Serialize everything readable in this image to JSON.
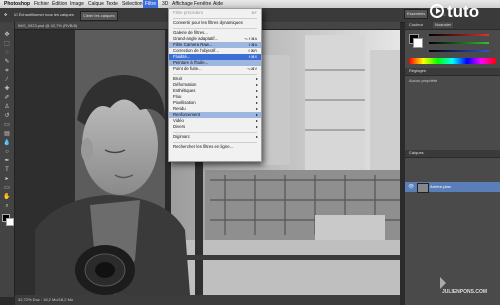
{
  "menubar": {
    "app": "Photoshop",
    "items": [
      "Fichier",
      "Édition",
      "Image",
      "Calque",
      "Texte",
      "Sélection",
      "Filtre",
      "3D",
      "Affichage",
      "Fenêtre",
      "Aide"
    ],
    "active": "Filtre"
  },
  "options_bar": {
    "items": [
      "Échantillonner tous les calques",
      "Cibler les calques",
      "Essentiels",
      "CC"
    ]
  },
  "document": {
    "tab_label": "IMG_0923.psd @ 42,7% (RVB/8)",
    "status_text": "42,72%   Doc : 18,2 Mo/18,2 Mo"
  },
  "filter_menu": {
    "items": [
      {
        "label": "Filtre précédent",
        "shortcut": "⌘F",
        "state": "disabled"
      },
      {
        "label": "",
        "separator": true
      },
      {
        "label": "Convertir pour les filtres dynamiques"
      },
      {
        "label": "",
        "separator": true
      },
      {
        "label": "Galerie de filtres..."
      },
      {
        "label": "Grand-angle adaptatif...",
        "shortcut": "⌥⇧⌘A"
      },
      {
        "label": "Filtre Camera Raw...",
        "shortcut": "⇧⌘A",
        "state": "highlight2"
      },
      {
        "label": "Correction de l'objectif...",
        "shortcut": "⇧⌘R"
      },
      {
        "label": "Fluidité...",
        "shortcut": "⇧⌘X",
        "state": "highlight"
      },
      {
        "label": "Peinture à l'huile...",
        "state": "highlight2"
      },
      {
        "label": "Point de fuite...",
        "shortcut": "⌥⌘V"
      },
      {
        "label": "",
        "separator": true
      },
      {
        "label": "Bruit",
        "submenu": true
      },
      {
        "label": "Déformation",
        "submenu": true
      },
      {
        "label": "Esthétiques",
        "submenu": true
      },
      {
        "label": "Flou",
        "submenu": true
      },
      {
        "label": "Pixellisation",
        "submenu": true
      },
      {
        "label": "Rendu",
        "submenu": true
      },
      {
        "label": "Renforcement",
        "submenu": true,
        "state": "highlight2"
      },
      {
        "label": "Vidéo",
        "submenu": true
      },
      {
        "label": "Divers",
        "submenu": true
      },
      {
        "label": "",
        "separator": true
      },
      {
        "label": "Digimarc",
        "submenu": true
      },
      {
        "label": "",
        "separator": true
      },
      {
        "label": "Rechercher les filtres en ligne..."
      }
    ]
  },
  "panels": {
    "color_tab": "Couleur",
    "swatches_tab": "Nuancier",
    "adjust_tab": "Réglages",
    "styles_tab": "Aucun propriété",
    "layers_tab": "Calques",
    "layer_name": "Arrière-plan",
    "slider_colors": [
      "#e03030",
      "#30c030",
      "#3050e0"
    ]
  },
  "watermark": {
    "brand": "tuto",
    "author": "JULIENPONS.COM"
  }
}
